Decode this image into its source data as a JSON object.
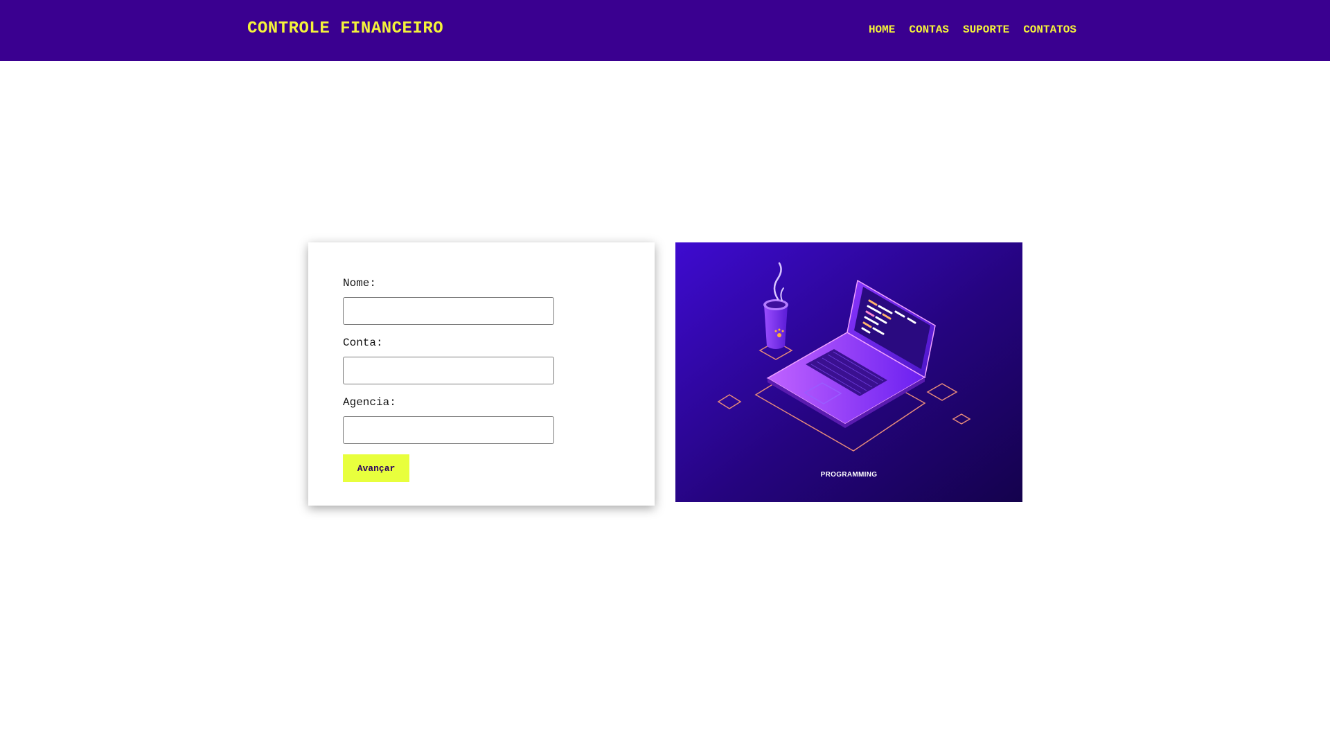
{
  "header": {
    "brand": "CONTROLE FINANCEIRO",
    "nav": [
      "HOME",
      "CONTAS",
      "SUPORTE",
      "CONTATOS"
    ]
  },
  "form": {
    "fields": [
      {
        "label": "Nome:",
        "value": ""
      },
      {
        "label": "Conta:",
        "value": ""
      },
      {
        "label": "Agencia:",
        "value": ""
      }
    ],
    "submit_label": "Avançar"
  },
  "illustration": {
    "caption": "PROGRAMMING",
    "icon": "laptop-coffee-icon"
  },
  "colors": {
    "header_bg": "#3a0090",
    "accent_yellow": "#f4f23a",
    "button_bg": "#e8ff3d"
  }
}
